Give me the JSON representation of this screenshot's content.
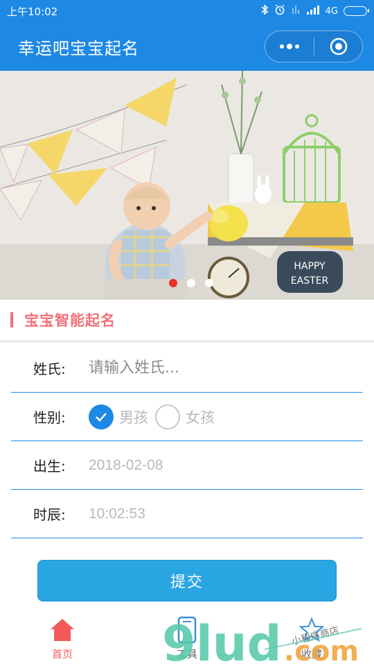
{
  "status_bar": {
    "time": "上午10:02",
    "network": "4G"
  },
  "nav": {
    "title": "幸运吧宝宝起名"
  },
  "banner": {
    "dots_total": 3,
    "active_dot": 1
  },
  "section": {
    "title": "宝宝智能起名"
  },
  "form": {
    "surname": {
      "label": "姓氏:",
      "value": "",
      "placeholder": "请输入姓氏..."
    },
    "gender": {
      "label": "性别:",
      "options": [
        "男孩",
        "女孩"
      ],
      "selected": "男孩"
    },
    "birth_date": {
      "label": "出生:",
      "value": "2018-02-08"
    },
    "birth_time": {
      "label": "时辰:",
      "value": "10:02:53"
    }
  },
  "submit_label": "提交",
  "tabs": [
    {
      "label": "首页",
      "icon": "home-icon",
      "active": true
    },
    {
      "label": "工具",
      "icon": "phone-icon",
      "active": false
    },
    {
      "label": "收藏",
      "icon": "star-icon",
      "active": false
    }
  ],
  "watermark": {
    "brand": "9lud.com",
    "tagline": "小程序商店"
  },
  "colors": {
    "primary": "#1e88e5",
    "accent_pink": "#f2707a",
    "button": "#2aa6e3",
    "active_tab": "#f25a5a",
    "active_dot": "#e8302a"
  }
}
